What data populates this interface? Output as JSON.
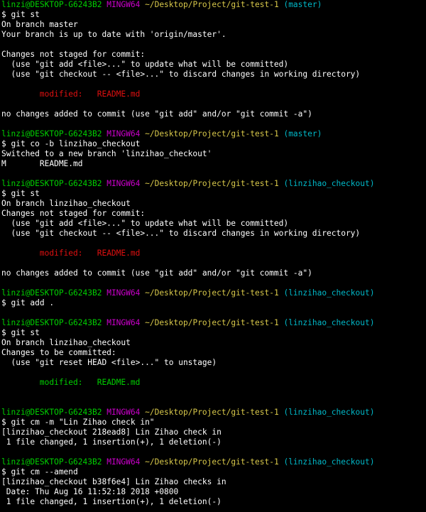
{
  "terminal": {
    "lines": [
      {
        "type": "prompt",
        "user_host": "linzi@DESKTOP-G6243B2",
        "shell": "MINGW64",
        "path": "~/Desktop/Project/git-test-1",
        "branch": "(master)"
      },
      {
        "type": "command",
        "text": "$ git st"
      },
      {
        "type": "text",
        "text": "On branch master"
      },
      {
        "type": "text",
        "text": "Your branch is up to date with 'origin/master'."
      },
      {
        "type": "blank"
      },
      {
        "type": "text",
        "text": "Changes not staged for commit:"
      },
      {
        "type": "text",
        "text": "  (use \"git add <file>...\" to update what will be committed)"
      },
      {
        "type": "text",
        "text": "  (use \"git checkout -- <file>...\" to discard changes in working directory)"
      },
      {
        "type": "blank"
      },
      {
        "type": "modified",
        "label": "        modified:   ",
        "file": "README.md"
      },
      {
        "type": "blank"
      },
      {
        "type": "text",
        "text": "no changes added to commit (use \"git add\" and/or \"git commit -a\")"
      },
      {
        "type": "blank"
      },
      {
        "type": "prompt",
        "user_host": "linzi@DESKTOP-G6243B2",
        "shell": "MINGW64",
        "path": "~/Desktop/Project/git-test-1",
        "branch": "(master)"
      },
      {
        "type": "command",
        "text": "$ git co -b linzihao_checkout"
      },
      {
        "type": "text",
        "text": "Switched to a new branch 'linzihao_checkout'"
      },
      {
        "type": "text",
        "text": "M       README.md"
      },
      {
        "type": "blank"
      },
      {
        "type": "prompt",
        "user_host": "linzi@DESKTOP-G6243B2",
        "shell": "MINGW64",
        "path": "~/Desktop/Project/git-test-1",
        "branch": "(linzihao_checkout)"
      },
      {
        "type": "command",
        "text": "$ git st"
      },
      {
        "type": "text",
        "text": "On branch linzihao_checkout"
      },
      {
        "type": "text",
        "text": "Changes not staged for commit:"
      },
      {
        "type": "text",
        "text": "  (use \"git add <file>...\" to update what will be committed)"
      },
      {
        "type": "text",
        "text": "  (use \"git checkout -- <file>...\" to discard changes in working directory)"
      },
      {
        "type": "blank"
      },
      {
        "type": "modified",
        "label": "        modified:   ",
        "file": "README.md"
      },
      {
        "type": "blank"
      },
      {
        "type": "text",
        "text": "no changes added to commit (use \"git add\" and/or \"git commit -a\")"
      },
      {
        "type": "blank"
      },
      {
        "type": "prompt",
        "user_host": "linzi@DESKTOP-G6243B2",
        "shell": "MINGW64",
        "path": "~/Desktop/Project/git-test-1",
        "branch": "(linzihao_checkout)"
      },
      {
        "type": "command",
        "text": "$ git add ."
      },
      {
        "type": "blank"
      },
      {
        "type": "prompt",
        "user_host": "linzi@DESKTOP-G6243B2",
        "shell": "MINGW64",
        "path": "~/Desktop/Project/git-test-1",
        "branch": "(linzihao_checkout)"
      },
      {
        "type": "command",
        "text": "$ git st"
      },
      {
        "type": "text",
        "text": "On branch linzihao_checkout"
      },
      {
        "type": "text",
        "text": "Changes to be committed:"
      },
      {
        "type": "text",
        "text": "  (use \"git reset HEAD <file>...\" to unstage)"
      },
      {
        "type": "blank"
      },
      {
        "type": "staged",
        "label": "        modified:   ",
        "file": "README.md"
      },
      {
        "type": "blank"
      },
      {
        "type": "blank"
      },
      {
        "type": "prompt",
        "user_host": "linzi@DESKTOP-G6243B2",
        "shell": "MINGW64",
        "path": "~/Desktop/Project/git-test-1",
        "branch": "(linzihao_checkout)"
      },
      {
        "type": "command",
        "text": "$ git cm -m \"Lin Zihao check in\""
      },
      {
        "type": "text",
        "text": "[linzihao_checkout 218ead8] Lin Zihao check in"
      },
      {
        "type": "text",
        "text": " 1 file changed, 1 insertion(+), 1 deletion(-)"
      },
      {
        "type": "blank"
      },
      {
        "type": "prompt",
        "user_host": "linzi@DESKTOP-G6243B2",
        "shell": "MINGW64",
        "path": "~/Desktop/Project/git-test-1",
        "branch": "(linzihao_checkout)"
      },
      {
        "type": "command",
        "text": "$ git cm --amend"
      },
      {
        "type": "text",
        "text": "[linzihao_checkout b38f6e4] Lin Zihao checks in"
      },
      {
        "type": "text",
        "text": " Date: Thu Aug 16 11:52:18 2018 +0800"
      },
      {
        "type": "text",
        "text": " 1 file changed, 1 insertion(+), 1 deletion(-)"
      }
    ]
  },
  "colors": {
    "background": "#000000",
    "text": "#ffffff",
    "user_host": "#00d000",
    "shell": "#cc00cc",
    "path": "#d8c84a",
    "branch": "#00b8c8",
    "modified": "#e01010",
    "staged": "#00d000"
  }
}
